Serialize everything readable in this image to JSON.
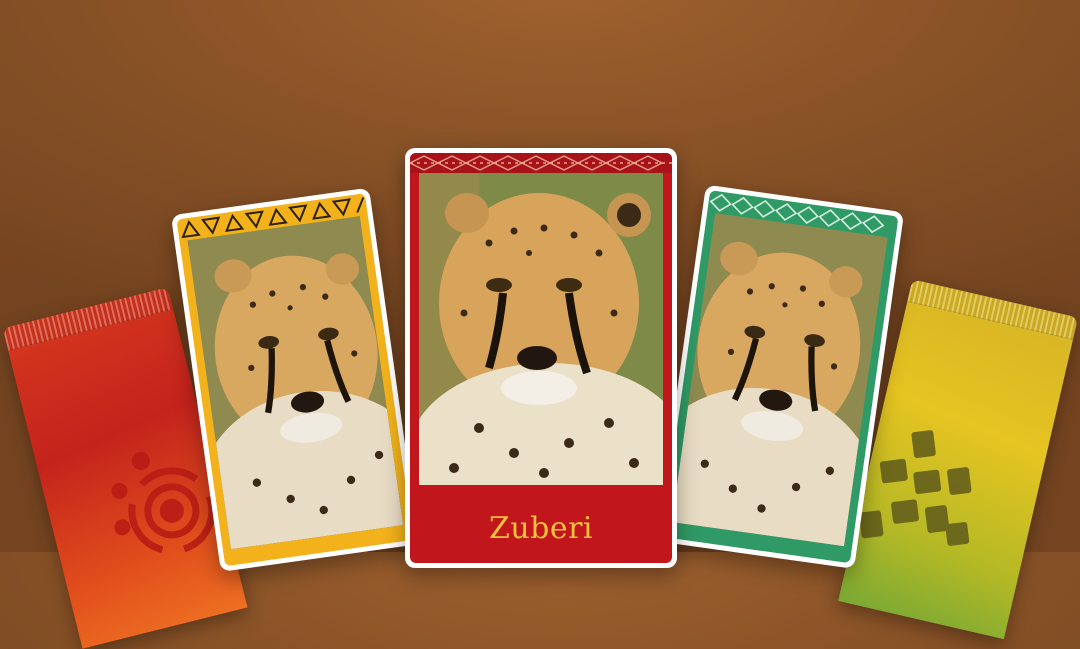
{
  "scene": {
    "featured_card": {
      "name": "Zuberi",
      "frame_color": "#c1171c",
      "name_color": "#f4c23a",
      "animal_icon": "cheetah-portrait"
    },
    "left_card": {
      "frame_color": "#f3b21b",
      "animal_icon": "cheetah-portrait",
      "band_pattern": "triangles"
    },
    "right_card": {
      "frame_color": "#2f9a66",
      "animal_icon": "cheetah-portrait",
      "band_pattern": "diamonds"
    },
    "left_pack": {
      "color": "#c4231c",
      "emblem_icon": "sun-spiral-icon"
    },
    "right_pack": {
      "color": "#e6c421",
      "emblem_icon": "woven-cross-icon"
    }
  }
}
